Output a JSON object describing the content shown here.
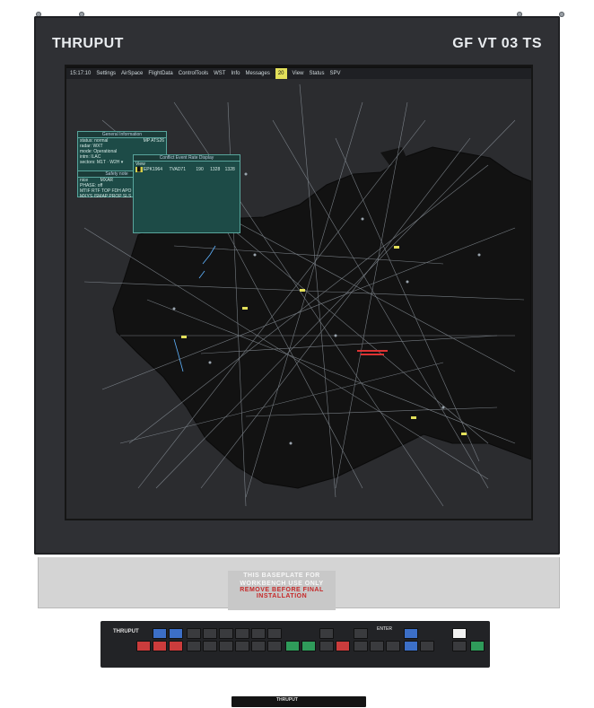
{
  "brand": {
    "left_logo": "THRUPUT",
    "right_model": "GF VT 03 TS"
  },
  "menubar": {
    "items": [
      "15:17:10",
      "Settings",
      "AirSpace",
      "FlightData",
      "ControlTools",
      "WST",
      "Info",
      "Messages",
      "20",
      "View",
      "Status",
      "SPV"
    ],
    "highlight_index": 8
  },
  "windows": {
    "general_info": {
      "title": "General Information",
      "rows": [
        "status: normal",
        "radar: WXT",
        "mode: Operational",
        "intm: ILAC",
        "sectors: M1T · W2H ▾"
      ],
      "right_text": "MP ATS26"
    },
    "safety_note": {
      "title": "Safety note",
      "rows": [
        "nice",
        "PHASE: off",
        "MTIF RTF TOP FDH APO",
        "MXYS ISMAP PROP SLS"
      ],
      "right_text": "MXAR"
    },
    "flight_plan": {
      "title": "Conflict Event Rate Display",
      "header": "View",
      "row": {
        "highlight": "█",
        "call": "EPK1964",
        "acc": "TVAD71",
        "alt": "190",
        "t1": "1328",
        "t2": "1328"
      }
    }
  },
  "baseplate": {
    "line1": "THIS BASEPLATE FOR",
    "line2": "WORKBENCH USE ONLY",
    "warning1": "REMOVE BEFORE FINAL",
    "warning2": "INSTALLATION"
  },
  "keyboard": {
    "logo": "THRUPUT",
    "enter_label": "ENTER"
  },
  "stick": {
    "label": "THRUPUT"
  },
  "colors": {
    "frame": "#2f3034",
    "screen": "#2b2c2f",
    "radar_land": "#121212",
    "radar_sea": "#2b2c2f",
    "accent_yellow": "#e3e05a",
    "window_teal": "#1d4b47",
    "warn_red": "#c62828"
  }
}
